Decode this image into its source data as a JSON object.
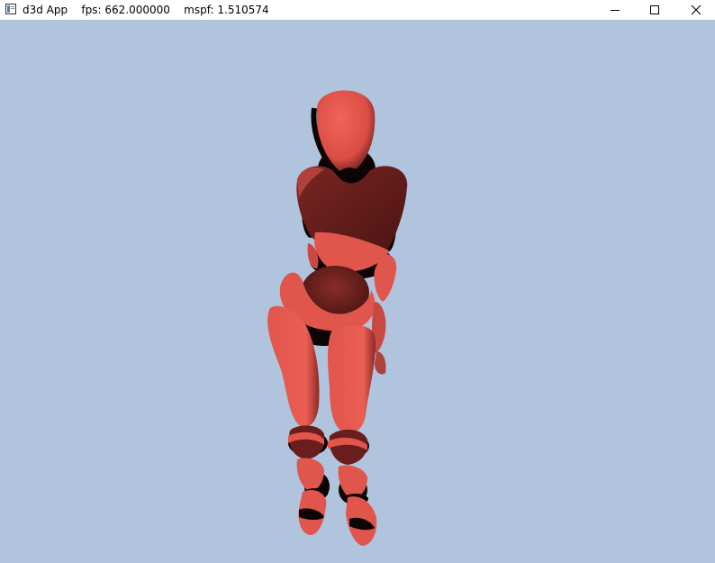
{
  "window": {
    "app_name": "d3d App",
    "fps_label": "fps:",
    "fps_value": "662.000000",
    "mspf_label": "mspf:",
    "mspf_value": "1.510574",
    "icons": {
      "app": "app-window-icon",
      "minimize": "minimize-icon",
      "maximize": "maximize-icon",
      "close": "close-icon"
    }
  },
  "viewport": {
    "background_color": "#b0c4de",
    "model_color": "#e0554c",
    "shadow_color": "#5a1a18"
  }
}
